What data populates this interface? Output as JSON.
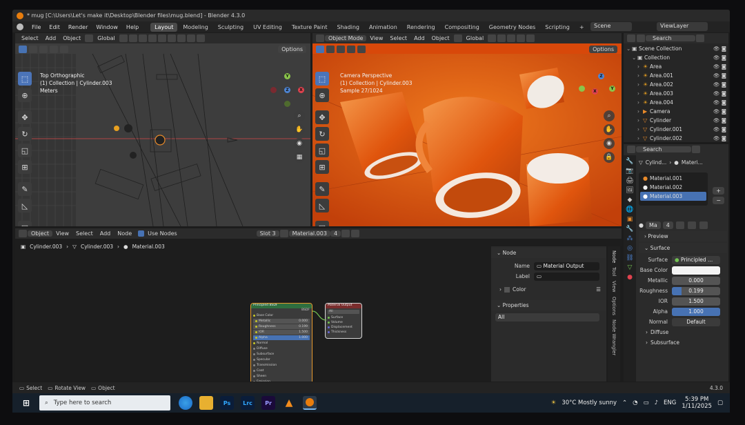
{
  "window_title": "* mug [C:\\Users\\Let's make it\\Desktop\\Blender files\\mug.blend] - Blender 4.3.0",
  "menus": [
    "File",
    "Edit",
    "Render",
    "Window",
    "Help"
  ],
  "workspace_tabs": [
    "Layout",
    "Modeling",
    "Sculpting",
    "UV Editing",
    "Texture Paint",
    "Shading",
    "Animation",
    "Rendering",
    "Compositing",
    "Geometry Nodes",
    "Scripting"
  ],
  "active_tab": "Layout",
  "add_workspace": "+",
  "scene_name": "Scene",
  "view_layer": "ViewLayer",
  "left_viewport": {
    "header": [
      "Select",
      "Add",
      "Object"
    ],
    "orientation": "Global",
    "options": "Options",
    "overlay": [
      "Top Orthographic",
      "(1) Collection | Cylinder.003",
      "Meters"
    ]
  },
  "right_viewport": {
    "mode": "Object Mode",
    "header": [
      "View",
      "Select",
      "Add",
      "Object"
    ],
    "orientation": "Global",
    "options": "Options",
    "overlay": [
      "Camera Perspective",
      "(1) Collection | Cylinder.003",
      "Sample 27/1024"
    ]
  },
  "gizmo": {
    "x": "X",
    "y": "Y",
    "z": "Z"
  },
  "outliner": {
    "search": "Search",
    "rows": [
      {
        "name": "Scene Collection",
        "icon": "▣",
        "depth": 0
      },
      {
        "name": "Collection",
        "icon": "▣",
        "depth": 1
      },
      {
        "name": "Area",
        "icon": "☀",
        "depth": 2
      },
      {
        "name": "Area.001",
        "icon": "☀",
        "depth": 2
      },
      {
        "name": "Area.002",
        "icon": "☀",
        "depth": 2
      },
      {
        "name": "Area.003",
        "icon": "☀",
        "depth": 2
      },
      {
        "name": "Area.004",
        "icon": "☀",
        "depth": 2
      },
      {
        "name": "Camera",
        "icon": "▶",
        "depth": 2
      },
      {
        "name": "Cylinder",
        "icon": "▽",
        "depth": 2
      },
      {
        "name": "Cylinder.001",
        "icon": "▽",
        "depth": 2
      },
      {
        "name": "Cylinder.002",
        "icon": "▽",
        "depth": 2
      }
    ]
  },
  "properties": {
    "search": "Search",
    "breadcrumb": [
      "Cylind...",
      "Materi..."
    ],
    "materials": [
      "Material.001",
      "Material.002",
      "Material.003"
    ],
    "active_material": "Material.003",
    "mat_field": "Ma",
    "mat_users": "4",
    "preview": "Preview",
    "surface_section": "Surface",
    "surface": {
      "label": "Surface",
      "value": "Principled ..."
    },
    "fields": [
      {
        "label": "Base Color",
        "value": ""
      },
      {
        "label": "Metallic",
        "value": "0.000"
      },
      {
        "label": "Roughness",
        "value": "0.199"
      },
      {
        "label": "IOR",
        "value": "1.500"
      },
      {
        "label": "Alpha",
        "value": "1.000"
      },
      {
        "label": "Normal",
        "value": "Default"
      }
    ],
    "roughness_fraction": 0.199,
    "alpha_fraction": 1.0,
    "subsections": [
      "Diffuse",
      "Subsurface"
    ]
  },
  "node_editor": {
    "type": "Object",
    "header": [
      "View",
      "Select",
      "Add",
      "Node"
    ],
    "use_nodes": "Use Nodes",
    "slot": "Slot 3",
    "material": "Material.003",
    "mat_users": "4",
    "breadcrumb": [
      "Cylinder.003",
      "Cylinder.003",
      "Material.003"
    ],
    "principled": {
      "title": "Principled BSDF",
      "out": "BSDF",
      "rows": [
        "Base Color",
        "Metallic",
        "Roughness",
        "IOR",
        "Alpha",
        "Normal",
        "Diffuse",
        "Subsurface",
        "Specular",
        "Transmission",
        "Coat",
        "Sheen",
        "Emission",
        "Thin Film"
      ],
      "values": {
        "Metallic": "0.000",
        "Roughness": "0.199",
        "IOR": "1.500",
        "Alpha": "1.000"
      }
    },
    "output": {
      "title": "Material Output",
      "target": "All",
      "rows": [
        "Surface",
        "Volume",
        "Displacement",
        "Thickness"
      ]
    }
  },
  "sidebar": {
    "node_section": "Node",
    "name_label": "Name",
    "name_value": "Material Output",
    "label_label": "Label",
    "color": "Color",
    "properties_section": "Properties",
    "properties_value": "All",
    "tabs": [
      "Node",
      "Tool",
      "View",
      "Options",
      "Node Wrangler"
    ]
  },
  "status_bar": {
    "items": [
      "Select",
      "Rotate View",
      "Object"
    ],
    "version": "4.3.0"
  },
  "taskbar": {
    "search": "Type here to search",
    "apps": [
      "Ps",
      "Lrc",
      "Pr"
    ],
    "weather": "30°C  Mostly sunny",
    "lang": "ENG",
    "time": "5:39 PM",
    "date": "1/11/2025"
  },
  "colors": {
    "accent": "#4772b3",
    "orange": "#e8600f",
    "green": "#73c252"
  }
}
